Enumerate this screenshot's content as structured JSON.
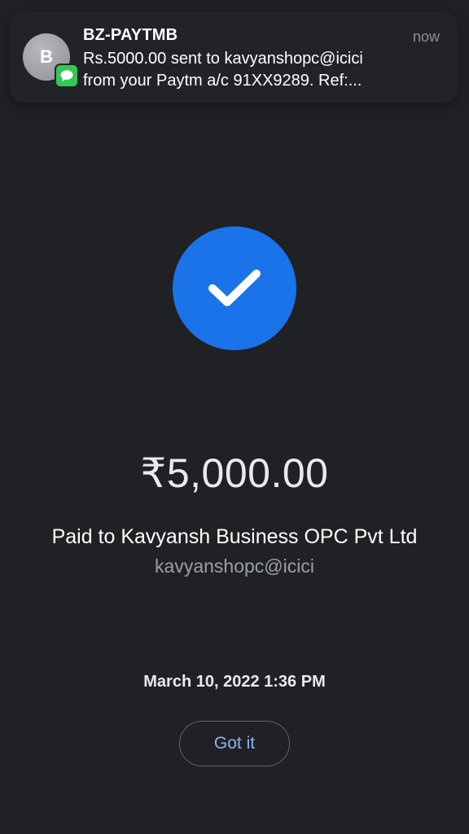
{
  "notification": {
    "avatar_letter": "B",
    "sender": "BZ-PAYTMB",
    "time": "now",
    "body": "Rs.5000.00 sent to kavyanshopc@icici\nfrom your Paytm a/c 91XX9289. Ref:...",
    "app_icon": "messages-icon",
    "app_color": "#34c759"
  },
  "payment": {
    "status_icon": "checkmark-icon",
    "status_color": "#1a73e8",
    "amount": "₹5,000.00",
    "paid_to": "Paid to Kavyansh Business OPC Pvt Ltd",
    "upi_id": "kavyanshopc@icici",
    "datetime": "March 10, 2022 1:36 PM"
  },
  "actions": {
    "got_it_label": "Got it"
  }
}
